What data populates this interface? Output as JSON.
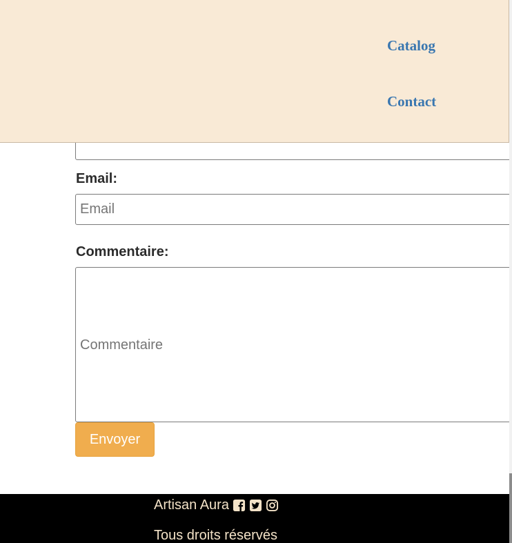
{
  "header": {
    "nav": {
      "catalog": "Catalog",
      "contact": "Contact"
    }
  },
  "form": {
    "email_label": "Email:",
    "email_placeholder": "Email",
    "comment_label": "Commentaire:",
    "comment_placeholder": "Commentaire",
    "submit_label": "Envoyer"
  },
  "footer": {
    "brand": "Artisan Aura",
    "social_icons": [
      "facebook-square-icon",
      "twitter-square-icon",
      "instagram-icon"
    ],
    "rights": "Tous droits réservés"
  },
  "colors": {
    "header_bg": "#f9ead6",
    "nav_link": "#3a77b0",
    "submit_bg": "#f0ad4e",
    "footer_bg": "#000000",
    "footer_text": "#f3e2c7"
  }
}
